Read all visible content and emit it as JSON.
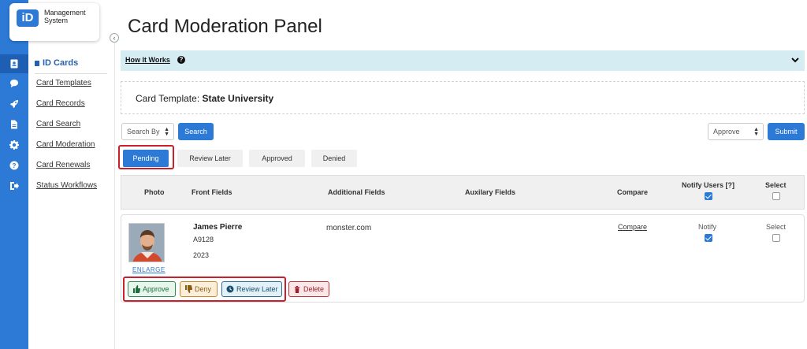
{
  "app": {
    "logo_badge": "iD",
    "logo_text": "Management System"
  },
  "rail": {
    "icons": [
      "id-card-icon",
      "chat-icon",
      "rocket-icon",
      "document-icon",
      "gear-icon",
      "help-icon",
      "logout-icon"
    ]
  },
  "sidebar": {
    "section_title": "ID Cards",
    "items": [
      {
        "label": "Card Templates"
      },
      {
        "label": "Card Records"
      },
      {
        "label": "Card Search"
      },
      {
        "label": "Card Moderation"
      },
      {
        "label": "Card Renewals"
      },
      {
        "label": "Status Workflows"
      }
    ]
  },
  "page": {
    "title": "Card Moderation Panel",
    "how_it_works": "How It Works",
    "card_template_label": "Card Template:",
    "card_template_value": "State University"
  },
  "toolbar": {
    "search_by": "Search By",
    "search_button": "Search",
    "action_select": "Approve",
    "submit_button": "Submit"
  },
  "tabs": [
    {
      "label": "Pending",
      "active": true
    },
    {
      "label": "Review Later",
      "active": false
    },
    {
      "label": "Approved",
      "active": false
    },
    {
      "label": "Denied",
      "active": false
    }
  ],
  "table": {
    "headers": {
      "photo": "Photo",
      "front": "Front Fields",
      "additional": "Additional Fields",
      "auxiliary": "Auxilary Fields",
      "compare": "Compare",
      "notify": "Notify Users [?]",
      "select": "Select"
    },
    "header_notify_checked": true,
    "header_select_checked": false,
    "rows": [
      {
        "name": "James Pierre",
        "id": "A9128",
        "year": "2023",
        "additional": "monster.com",
        "compare": "Compare",
        "notify_label": "Notify",
        "notify_checked": true,
        "select_label": "Select",
        "select_checked": false,
        "enlarge": "ENLARGE"
      }
    ]
  },
  "actions": {
    "approve": "Approve",
    "deny": "Deny",
    "review_later": "Review Later",
    "delete": "Delete"
  },
  "colors": {
    "primary": "#2d7ad6",
    "highlight_outline": "#c8202d",
    "info_bar": "#d6ecf3"
  }
}
